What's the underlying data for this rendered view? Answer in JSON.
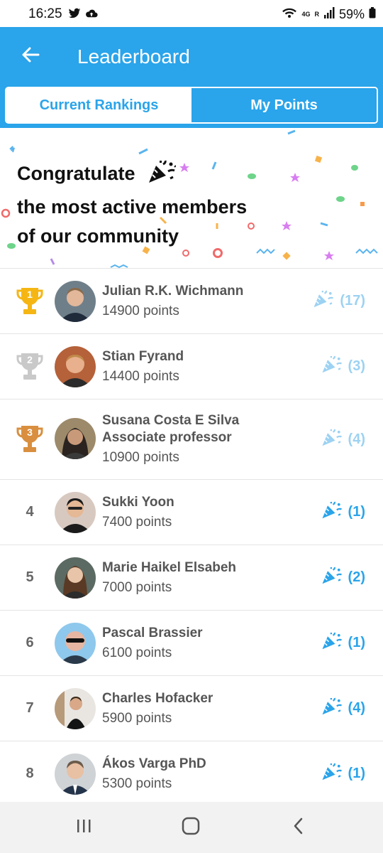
{
  "status_bar": {
    "time": "16:25",
    "battery_percent": "59%",
    "network_label": "4G",
    "sim_label": "R"
  },
  "app_bar": {
    "title": "Leaderboard",
    "background_color": "#2aa4ea"
  },
  "tabs": [
    {
      "label": "Current Rankings",
      "selected": true
    },
    {
      "label": "My Points",
      "selected": false
    }
  ],
  "banner": {
    "line1": "Congratulate",
    "line2": "the most active members",
    "line3": "of our community",
    "icon": "party-popper-icon"
  },
  "leaderboard": [
    {
      "rank": "1",
      "name": "Julian R.K. Wichmann",
      "subtitle": "",
      "points": "14900 points",
      "congrats": "(17)",
      "trophy": "gold"
    },
    {
      "rank": "2",
      "name": "Stian Fyrand",
      "subtitle": "",
      "points": "14400 points",
      "congrats": "(3)",
      "trophy": "silver"
    },
    {
      "rank": "3",
      "name": "Susana Costa E Silva",
      "subtitle": "Associate professor",
      "points": "10900 points",
      "congrats": "(4)",
      "trophy": "bronze"
    },
    {
      "rank": "4",
      "name": "Sukki Yoon",
      "subtitle": "",
      "points": "7400 points",
      "congrats": "(1)",
      "trophy": ""
    },
    {
      "rank": "5",
      "name": "Marie Haikel Elsabeh",
      "subtitle": "",
      "points": "7000 points",
      "congrats": "(2)",
      "trophy": ""
    },
    {
      "rank": "6",
      "name": "Pascal Brassier",
      "subtitle": "",
      "points": "6100 points",
      "congrats": "(1)",
      "trophy": ""
    },
    {
      "rank": "7",
      "name": "Charles Hofacker",
      "subtitle": "",
      "points": "5900 points",
      "congrats": "(4)",
      "trophy": ""
    },
    {
      "rank": "8",
      "name": "Ákos Varga PhD",
      "subtitle": "",
      "points": "5300 points",
      "congrats": "(1)",
      "trophy": ""
    }
  ],
  "colors": {
    "accent": "#2aa4ea",
    "gold": "#f5b614",
    "silver": "#c9c9c9",
    "bronze": "#d98f3f"
  },
  "nav_bar": {
    "recents_icon": "recents-icon",
    "home_icon": "home-icon",
    "back_icon": "back-chevron-icon"
  }
}
